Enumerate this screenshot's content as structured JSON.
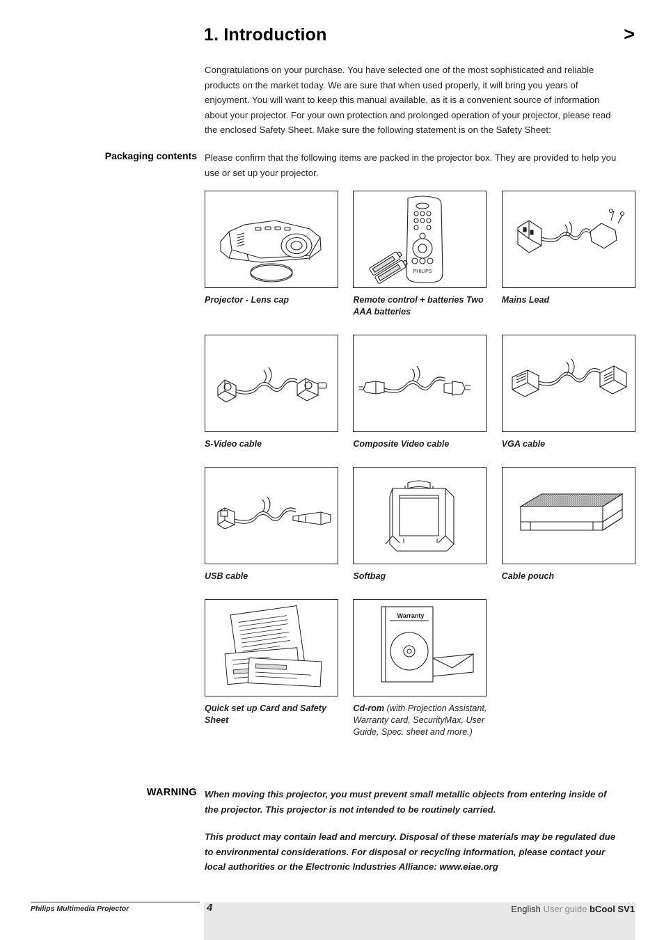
{
  "header": {
    "title": "1. Introduction",
    "chevron": ">"
  },
  "intro": {
    "paragraph": "Congratulations on your purchase. You have selected one of the most sophisticated and reliable products on the market today. We are sure that when used properly, it will bring you years of enjoyment. You will want to keep this manual available, as it is a convenient source of information about your projector. For your own protection and prolonged operation of your projector, please read the enclosed Safety Sheet. Make sure the following statement is on the Safety Sheet:"
  },
  "packaging": {
    "label": "Packaging contents",
    "text": "Please confirm that the following items are packed in the projector box. They are provided to help you use or set up your projector.",
    "items": [
      {
        "caption": "Projector - Lens cap",
        "icon": "projector-icon"
      },
      {
        "caption": "Remote control + batteries Two AAA batteries",
        "icon": "remote-control-icon"
      },
      {
        "caption": "Mains Lead",
        "icon": "mains-lead-icon"
      },
      {
        "caption": "S-Video cable",
        "icon": "s-video-cable-icon"
      },
      {
        "caption": "Composite Video cable",
        "icon": "composite-video-cable-icon"
      },
      {
        "caption": "VGA cable",
        "icon": "vga-cable-icon"
      },
      {
        "caption": "USB cable",
        "icon": "usb-cable-icon"
      },
      {
        "caption": "Softbag",
        "icon": "softbag-icon"
      },
      {
        "caption": "Cable pouch",
        "icon": "cable-pouch-icon"
      },
      {
        "caption": "Quick set up Card and Safety Sheet",
        "icon": "documents-icon"
      },
      {
        "caption": "Cd-rom",
        "caption_note": " (with Projection Assistant, Warranty card, SecurityMax, User Guide, Spec. sheet and more.)",
        "icon": "cdrom-icon"
      }
    ],
    "cdrom_disc_label": "Warranty"
  },
  "warning": {
    "label": "WARNING",
    "paragraph1": "When moving this projector, you must prevent small metallic objects from entering inside of the projector. This projector is not intended to be routinely carried.",
    "paragraph2": "This product may contain lead and mercury. Disposal of these materials may be regulated due to environmental considerations. For disposal or recycling information, please contact your local authorities or the Electronic Industries Alliance: www.eiae.org"
  },
  "footer": {
    "left": "Philips Multimedia Projector",
    "page": "4",
    "right_english": "English",
    "right_userguide": "User guide",
    "right_model": "bCool SV1"
  }
}
